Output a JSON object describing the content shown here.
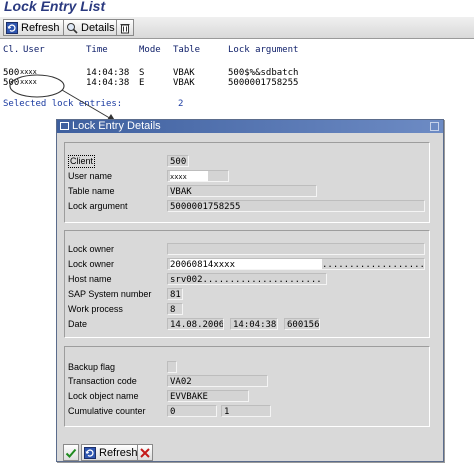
{
  "window": {
    "title": "Lock Entry List"
  },
  "toolbar": {
    "refresh_label": "Refresh",
    "details_label": "Details"
  },
  "table": {
    "headers": [
      "Cl.",
      "User",
      "Time",
      "Mode",
      "Table",
      "Lock argument"
    ],
    "rows": [
      {
        "client": "500",
        "user": "xxxx",
        "time": "14:04:38",
        "mode": "S",
        "table": "VBAK",
        "argument": "500$%&sdbatch"
      },
      {
        "client": "500",
        "user": "xxxx",
        "time": "14:04:38",
        "mode": "E",
        "table": "VBAK",
        "argument": "5000001758255"
      }
    ],
    "summary_label": "Selected lock entries:",
    "summary_count": "2"
  },
  "dialog": {
    "title": "Lock Entry Details",
    "group1": {
      "client_label": "Client",
      "client_value": "500",
      "user_label": "User name",
      "user_value": "xxxx",
      "table_label": "Table name",
      "table_value": "VBAK",
      "arg_label": "Lock argument",
      "arg_value": "5000001758255"
    },
    "group2": {
      "owner1_label": "Lock owner",
      "owner1_value": "",
      "owner2_label": "Lock owner",
      "owner2_value": "20060814xxxx",
      "owner2_suffix": "...................",
      "host_label": "Host name",
      "host_value": "srv002......................",
      "sysnum_label": "SAP System number",
      "sysnum_value": "81",
      "wp_label": "Work process",
      "wp_value": "8",
      "date_label": "Date",
      "date_value": "14.08.2006",
      "time_value": "14:04:38",
      "micro_value": "600156"
    },
    "group3": {
      "backup_label": "Backup flag",
      "tcode_label": "Transaction code",
      "tcode_value": "VA02",
      "lockobj_label": "Lock object name",
      "lockobj_value": "EVVBAKE",
      "counter_label": "Cumulative counter",
      "counter1_value": "0",
      "counter2_value": "1"
    },
    "footer": {
      "refresh_label": "Refresh"
    }
  }
}
